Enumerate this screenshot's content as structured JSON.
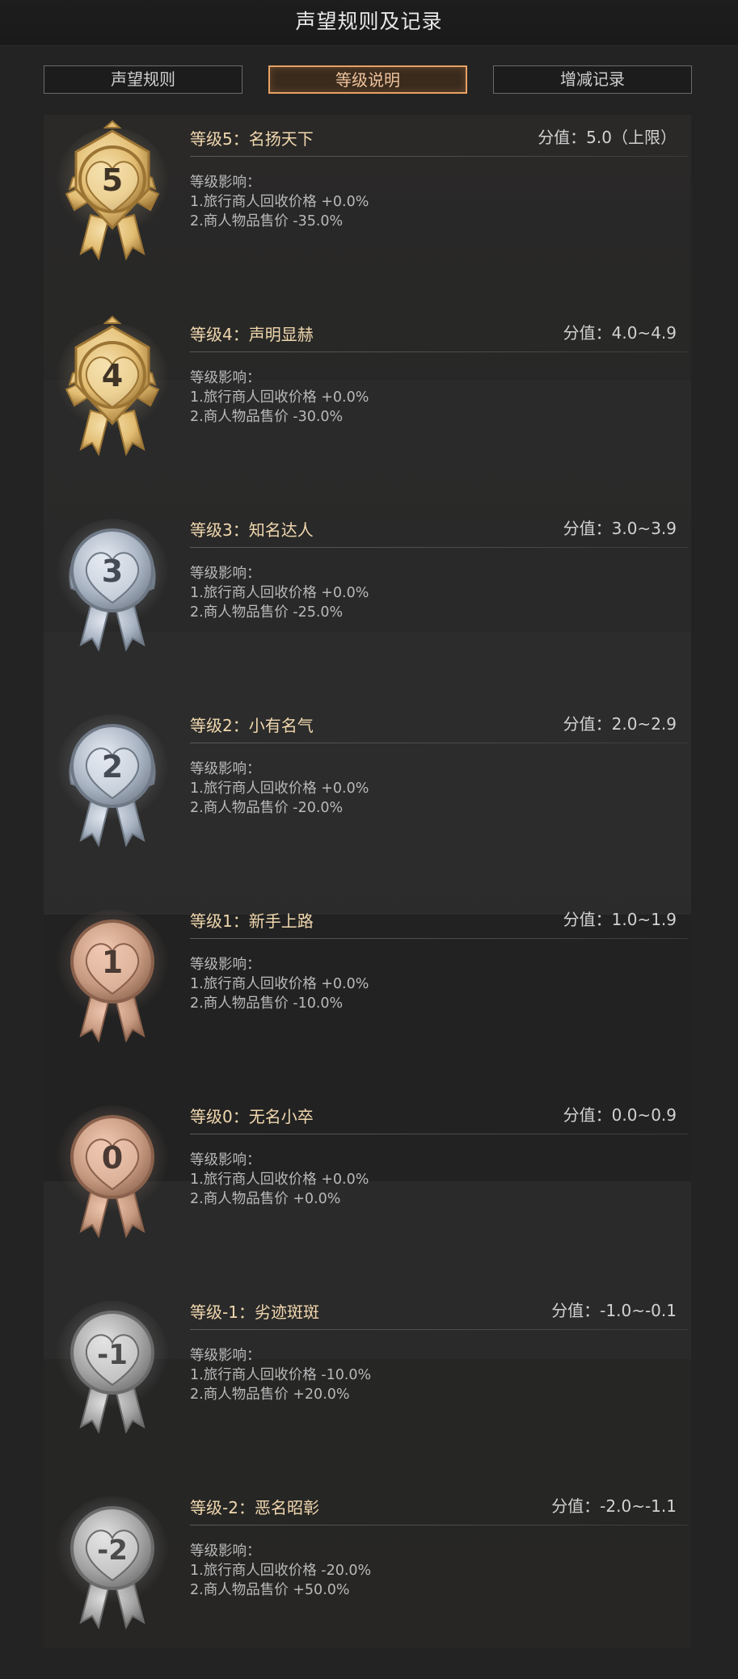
{
  "header": {
    "title": "声望规则及记录"
  },
  "tabs": [
    {
      "label": "声望规则",
      "active": false
    },
    {
      "label": "等级说明",
      "active": true
    },
    {
      "label": "增减记录",
      "active": false
    }
  ],
  "colors": {
    "accent": "#e8a165",
    "gold": "#e6c27a",
    "silver": "#a8b3c2",
    "bronze": "#c79a7e",
    "iron": "#9a9a9a"
  },
  "levels": [
    {
      "medal_text": "5",
      "medal_tier": "gold",
      "medal_style": "wing",
      "name": "等级5：名扬天下",
      "score": "分值：5.0（上限）",
      "effects_title": "等级影响：",
      "effect1": "1.旅行商人回收价格 +0.0%",
      "effect2": "2.商人物品售价 -35.0%"
    },
    {
      "medal_text": "4",
      "medal_tier": "gold",
      "medal_style": "wing",
      "name": "等级4：声明显赫",
      "score": "分值：4.0~4.9",
      "effects_title": "等级影响：",
      "effect1": "1.旅行商人回收价格 +0.0%",
      "effect2": "2.商人物品售价 -30.0%"
    },
    {
      "medal_text": "3",
      "medal_tier": "silver",
      "medal_style": "laurel",
      "name": "等级3：知名达人",
      "score": "分值：3.0~3.9",
      "effects_title": "等级影响：",
      "effect1": "1.旅行商人回收价格 +0.0%",
      "effect2": "2.商人物品售价 -25.0%"
    },
    {
      "medal_text": "2",
      "medal_tier": "silver",
      "medal_style": "laurel",
      "name": "等级2：小有名气",
      "score": "分值：2.0~2.9",
      "effects_title": "等级影响：",
      "effect1": "1.旅行商人回收价格 +0.0%",
      "effect2": "2.商人物品售价 -20.0%"
    },
    {
      "medal_text": "1",
      "medal_tier": "bronze",
      "medal_style": "plain",
      "name": "等级1：新手上路",
      "score": "分值：1.0~1.9",
      "effects_title": "等级影响：",
      "effect1": "1.旅行商人回收价格 +0.0%",
      "effect2": "2.商人物品售价 -10.0%"
    },
    {
      "medal_text": "0",
      "medal_tier": "bronze",
      "medal_style": "plain",
      "name": "等级0：无名小卒",
      "score": "分值：0.0~0.9",
      "effects_title": "等级影响：",
      "effect1": "1.旅行商人回收价格 +0.0%",
      "effect2": "2.商人物品售价 +0.0%"
    },
    {
      "medal_text": "-1",
      "medal_tier": "iron",
      "medal_style": "plain",
      "name": "等级-1：劣迹斑斑",
      "score": "分值：-1.0~-0.1",
      "effects_title": "等级影响：",
      "effect1": "1.旅行商人回收价格 -10.0%",
      "effect2": "2.商人物品售价 +20.0%"
    },
    {
      "medal_text": "-2",
      "medal_tier": "iron",
      "medal_style": "plain",
      "name": "等级-2：恶名昭彰",
      "score": "分值：-2.0~-1.1",
      "effects_title": "等级影响：",
      "effect1": "1.旅行商人回收价格 -20.0%",
      "effect2": "2.商人物品售价 +50.0%"
    }
  ]
}
